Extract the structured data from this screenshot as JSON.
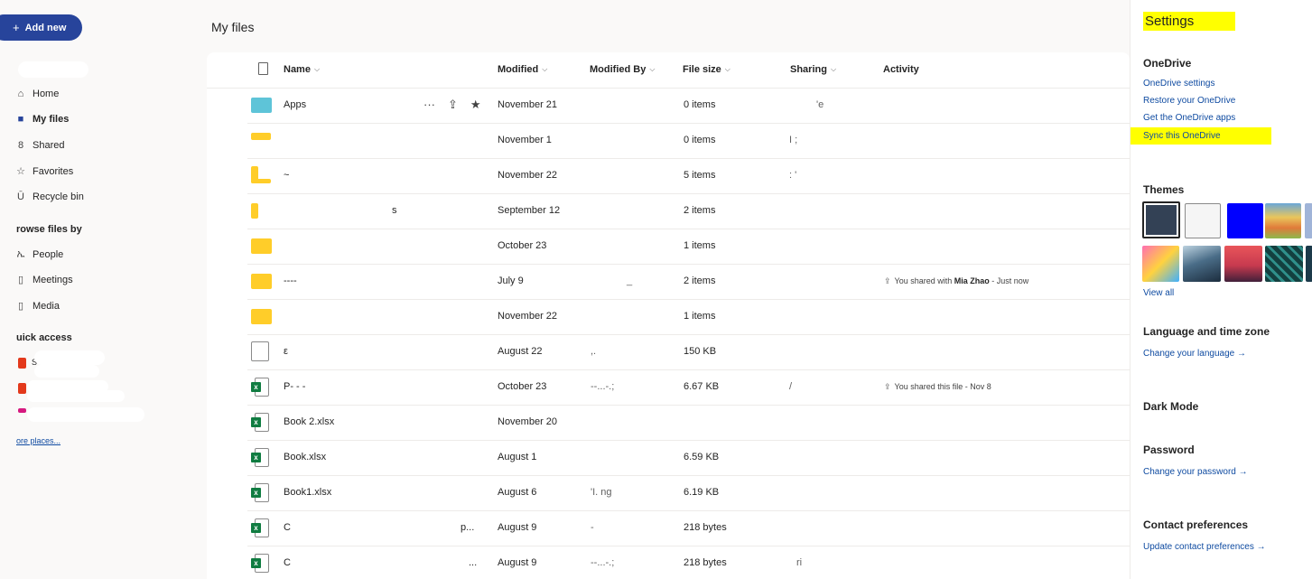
{
  "nav": {
    "add_new": "Add new",
    "items": [
      {
        "label": "Home",
        "icon": "home-icon"
      },
      {
        "label": "My files",
        "icon": "folder-icon"
      },
      {
        "label": "Shared",
        "icon": "people-icon"
      },
      {
        "label": "Favorites",
        "icon": "star-icon"
      },
      {
        "label": "Recycle bin",
        "icon": "trash-icon"
      }
    ],
    "browse_heading": "rowse files by",
    "browse_items": [
      {
        "label": "People",
        "icon": "person-icon"
      },
      {
        "label": "Meetings",
        "icon": "calendar-icon"
      },
      {
        "label": "Media",
        "icon": "media-icon"
      }
    ],
    "quick_access_heading": "uick access",
    "quick_access_item_1": "S",
    "more_places": "ore places..."
  },
  "main": {
    "title": "My files",
    "columns": {
      "name": "Name",
      "modified": "Modified",
      "modified_by": "Modified By",
      "file_size": "File size",
      "sharing": "Sharing",
      "activity": "Activity"
    },
    "rows": [
      {
        "name": "Apps",
        "modified": "November 21",
        "by": "",
        "size": "0 items",
        "sharing": "'e",
        "activity": ""
      },
      {
        "name": "",
        "modified": "November 1",
        "by": "",
        "size": "0 items",
        "sharing": "I  ;",
        "activity": ""
      },
      {
        "name": "       ~",
        "modified": "November 22",
        "by": "",
        "size": "5 items",
        "sharing": "   :   '",
        "activity": ""
      },
      {
        "name": "s",
        "modified": "September 12",
        "by": "",
        "size": "2 items",
        "sharing": "",
        "activity": ""
      },
      {
        "name": "",
        "modified": "October 23",
        "by": "",
        "size": "1 items",
        "sharing": "",
        "activity": ""
      },
      {
        "name": "----",
        "modified": "July 9",
        "by": "_",
        "size": "2 items",
        "sharing": "",
        "activity_pre": "You shared with ",
        "activity_person": "Mia Zhao",
        "activity_post": " - Just now"
      },
      {
        "name": "",
        "modified": "November 22",
        "by": "",
        "size": "1 items",
        "sharing": "",
        "activity": ""
      },
      {
        "name": "ε",
        "modified": "August 22",
        "by": ",.",
        "size": "150 KB",
        "sharing": "",
        "activity": ""
      },
      {
        "name": "P-  -  -",
        "modified": "October 23",
        "by": "--...-.;",
        "size": "6.67 KB",
        "sharing": "/",
        "activity_pre": "You shared this file - Nov 8",
        "activity_person": "",
        "activity_post": ""
      },
      {
        "name": "Book 2.xlsx",
        "modified": "November 20",
        "by": "",
        "size": "",
        "sharing": "",
        "activity": ""
      },
      {
        "name": "Book.xlsx",
        "modified": "August 1",
        "by": "",
        "size": "6.59 KB",
        "sharing": "",
        "activity": ""
      },
      {
        "name": "Book1.xlsx",
        "modified": "August 6",
        "by": "'I.      ng",
        "size": "6.19 KB",
        "sharing": "",
        "activity": ""
      },
      {
        "name": "C",
        "name_tail": "p...",
        "modified": "August 9",
        "by": "-",
        "size": "218 bytes",
        "sharing": "",
        "activity": ""
      },
      {
        "name": "C",
        "name_tail": "...",
        "modified": "August 9",
        "by": "--...-.;",
        "size": "218 bytes",
        "sharing": "ri",
        "activity": ""
      }
    ]
  },
  "settings": {
    "title": "Settings",
    "onedrive_heading": "OneDrive",
    "links": [
      "OneDrive settings",
      "Restore your OneDrive",
      "Get the OneDrive apps",
      "Sync this OneDrive"
    ],
    "themes_heading": "Themes",
    "view_all": "View all",
    "lang_heading": "Language and time zone",
    "lang_link": "Change your language →",
    "dark_heading": "Dark Mode",
    "password_heading": "Password",
    "password_link": "Change your password →",
    "contact_heading": "Contact preferences",
    "contact_link": "Update contact preferences →"
  },
  "colors": {
    "accent": "#27449b",
    "link": "#0f4ba1",
    "highlight": "#ffff00",
    "excel": "#107c41",
    "folder": "#ffcd29"
  }
}
